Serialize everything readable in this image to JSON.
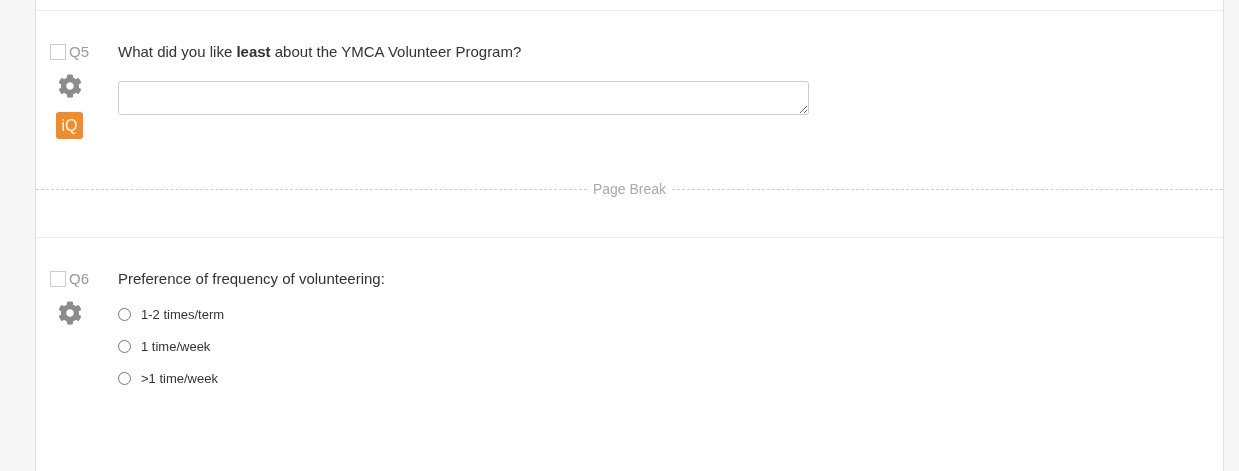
{
  "questions": [
    {
      "kind": "text_entry",
      "number": "Q5",
      "checked": false,
      "text": "What did you like **least** about the YMCA Volunteer Program?",
      "badge": "iQ"
    },
    {
      "kind": "page_break",
      "label": "Page Break"
    },
    {
      "kind": "multiple_choice",
      "number": "Q6",
      "checked": false,
      "text": "Preference of frequency of volunteering:",
      "choices": [
        {
          "label": "1-2 times/term",
          "selected": false
        },
        {
          "label": "1 time/week",
          "selected": false
        },
        {
          "label": ">1 time/week",
          "selected": false
        }
      ]
    }
  ]
}
